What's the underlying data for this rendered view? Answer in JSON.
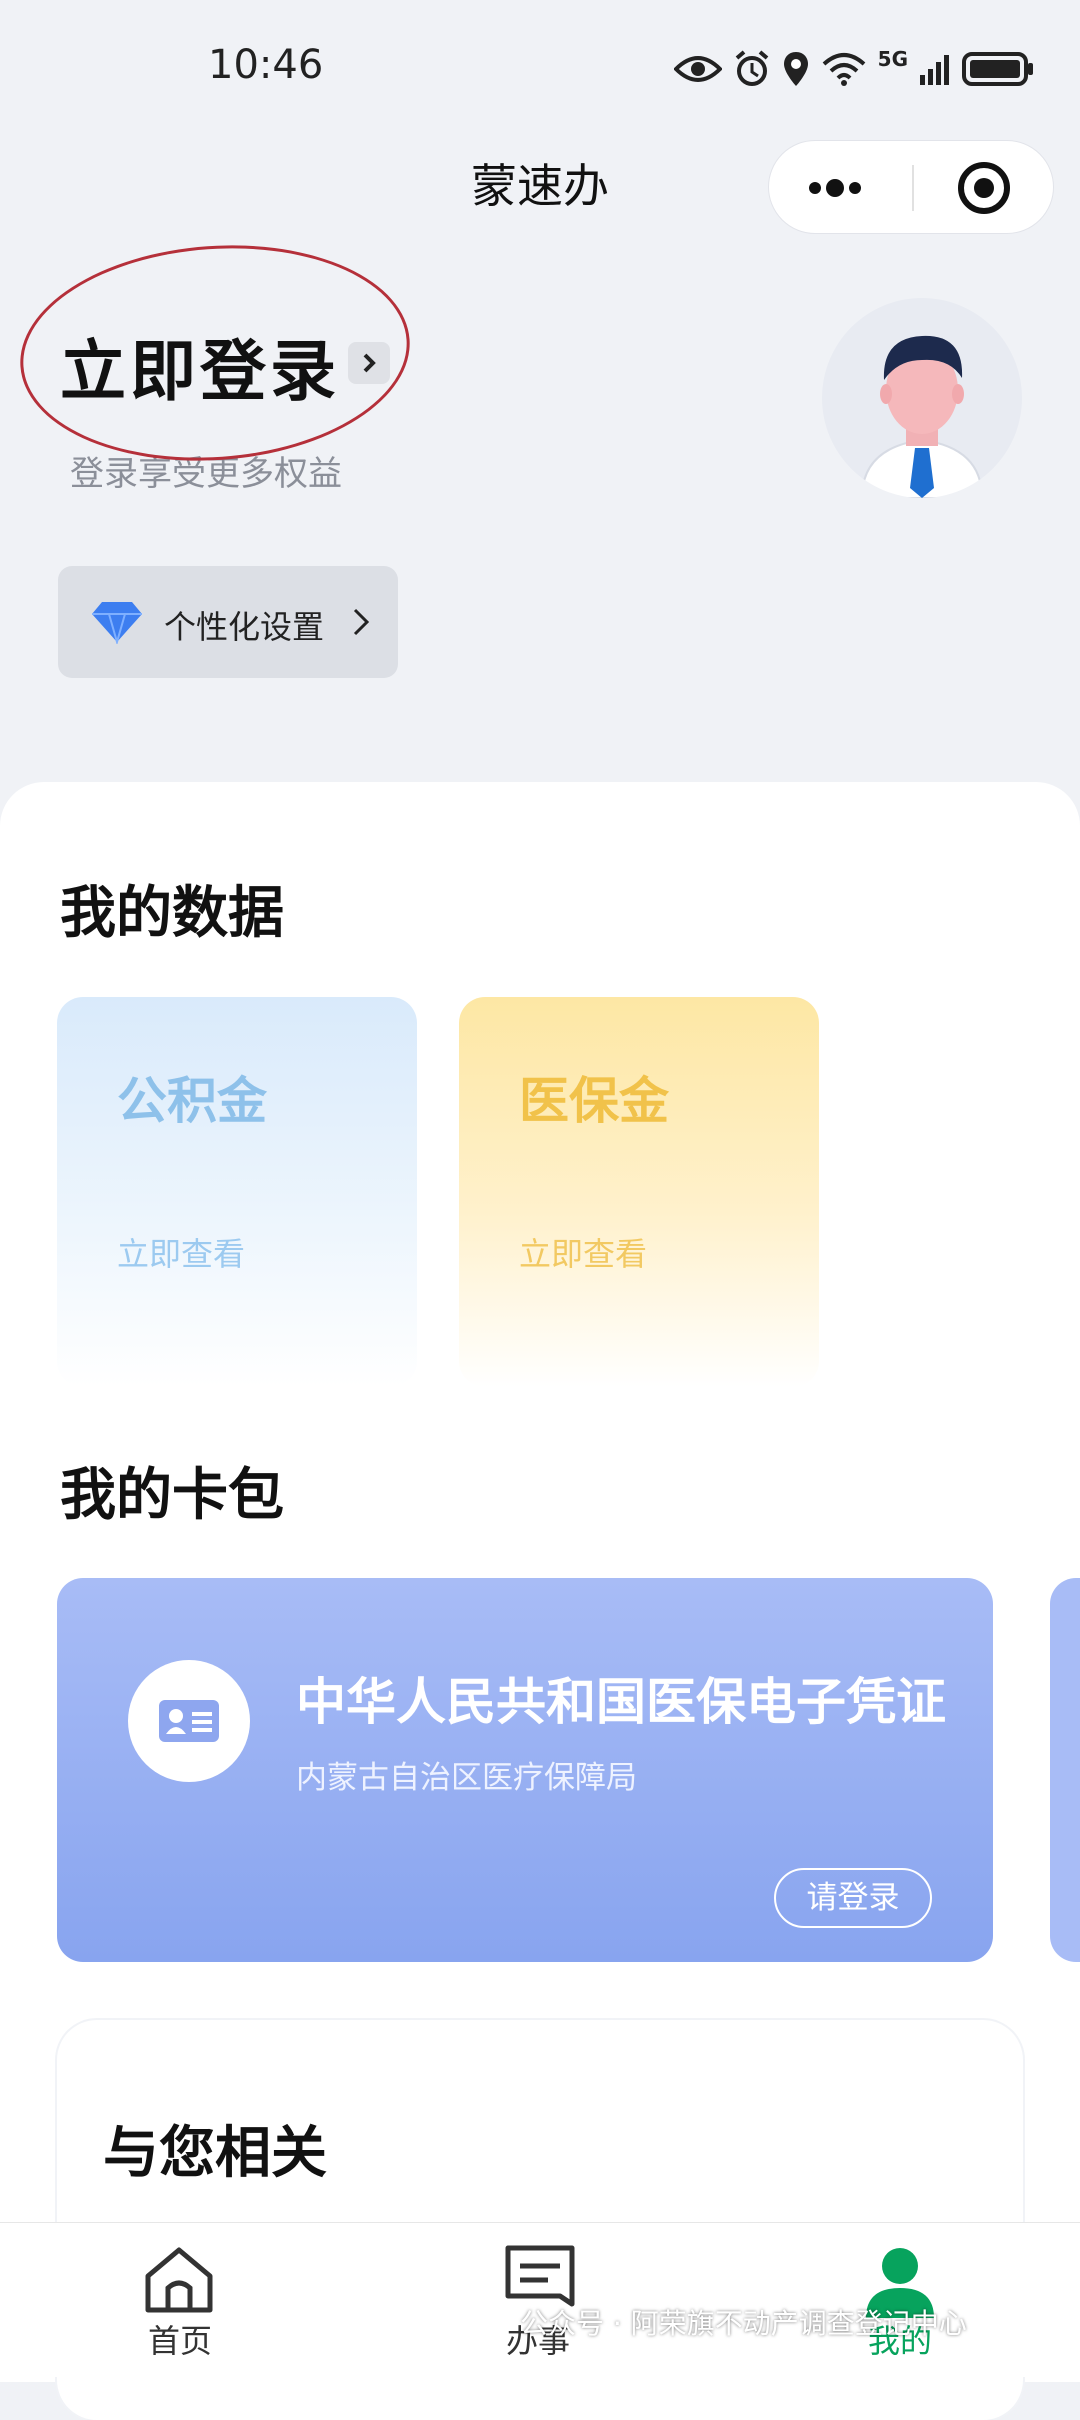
{
  "status_bar": {
    "time": "10:46",
    "network": "5G"
  },
  "nav": {
    "title": "蒙速办"
  },
  "header": {
    "login_title": "立即登录",
    "login_subtitle": "登录享受更多权益",
    "personal_settings": "个性化设置"
  },
  "my_data": {
    "title": "我的数据",
    "cards": [
      {
        "title": "公积金",
        "action": "立即查看"
      },
      {
        "title": "医保金",
        "action": "立即查看"
      }
    ]
  },
  "wallet": {
    "title": "我的卡包",
    "card_title": "中华人民共和国医保电子凭证",
    "card_issuer": "内蒙古自治区医疗保障局",
    "card_action": "请登录"
  },
  "related": {
    "title": "与您相关"
  },
  "tabbar": {
    "home": "首页",
    "tasks": "办事",
    "mine": "我的"
  },
  "watermark": "公众号 · 阿荣旗不动产调查登记中心",
  "colors": {
    "accent_green": "#07a35d",
    "annotation_red": "#b5303a",
    "wallet_blue": "#88a4ef"
  }
}
